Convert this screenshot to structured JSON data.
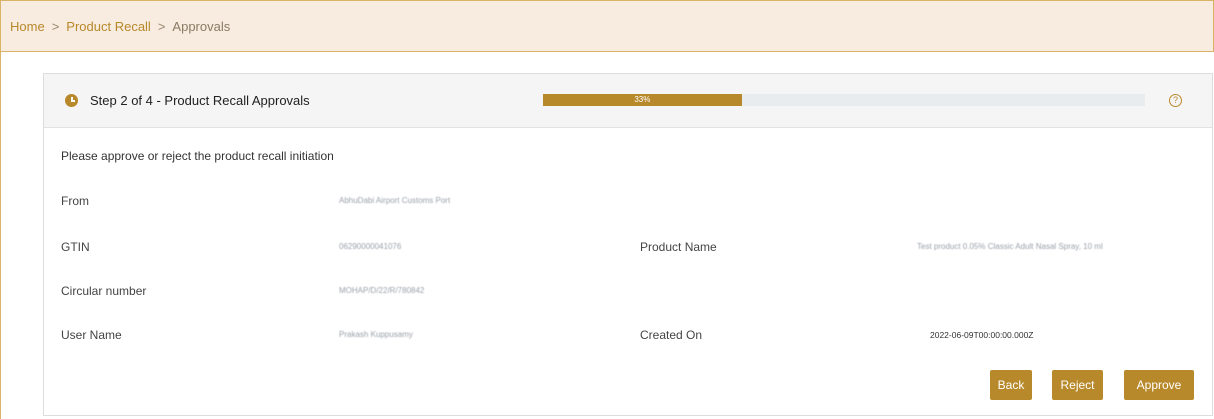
{
  "breadcrumb": {
    "items": [
      "Home",
      "Product Recall"
    ],
    "current": "Approvals",
    "separator": ">"
  },
  "step": {
    "title": "Step 2 of 4 - Product Recall Approvals",
    "progress_percent": 33,
    "progress_label": "33%"
  },
  "instruction": "Please approve or reject the product recall initiation",
  "fields": {
    "from": {
      "label": "From",
      "value": "AbhuDabi Airport Customs Port"
    },
    "gtin": {
      "label": "GTIN",
      "value": "06290000041076"
    },
    "product_name": {
      "label": "Product Name",
      "value": "Test product 0.05% Classic Adult Nasal Spray, 10 ml"
    },
    "circular_number": {
      "label": "Circular number",
      "value": "MOHAP/D/22/R/780842"
    },
    "user_name": {
      "label": "User Name",
      "value": "Prakash Kuppusamy"
    },
    "created_on": {
      "label": "Created On",
      "value": "2022-06-09T00:00:00.000Z"
    }
  },
  "buttons": {
    "back": "Back",
    "reject": "Reject",
    "approve": "Approve"
  },
  "colors": {
    "accent": "#b8892b",
    "header_bg": "#f8ebdf"
  },
  "icons": {
    "step": "clock-icon",
    "help": "help-circle-icon"
  }
}
